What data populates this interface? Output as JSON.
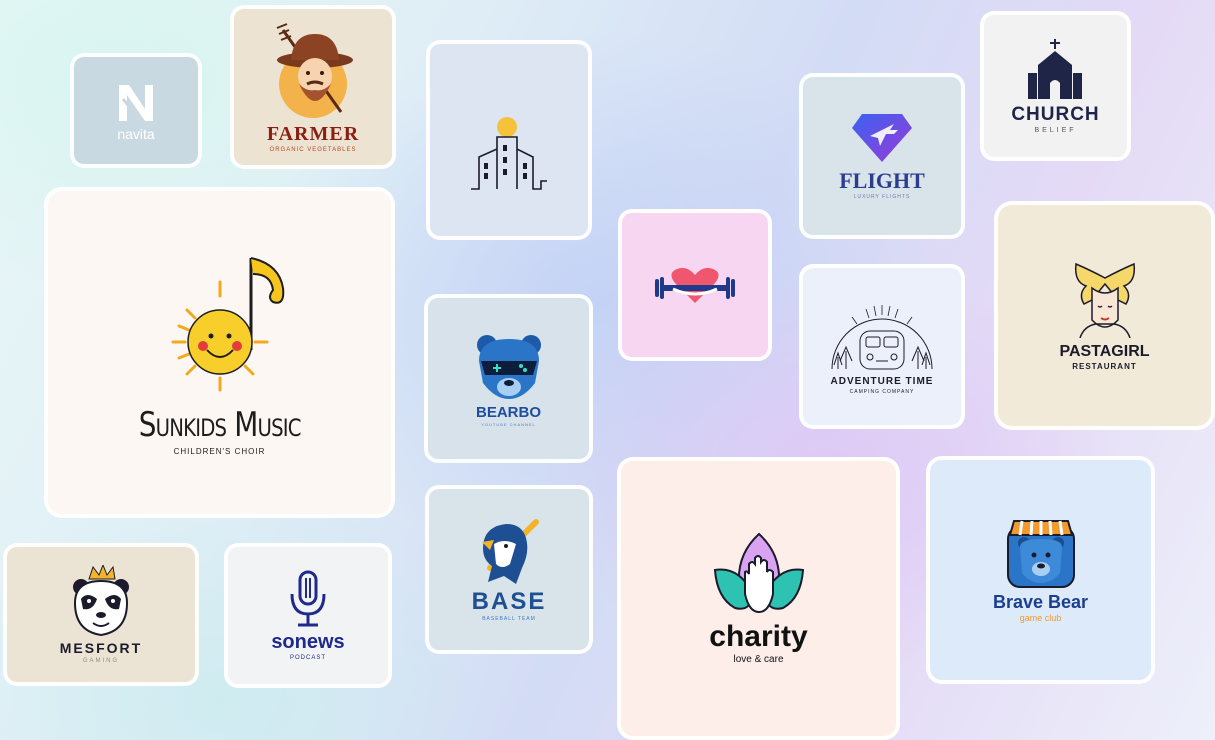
{
  "logos": {
    "navita": {
      "name": "navita",
      "letter": "N"
    },
    "farmer": {
      "name": "FARMER",
      "tagline": "ORGANIC VEGETABLES"
    },
    "sunkids": {
      "name": "Sunkids Music",
      "tagline": "CHILDREN'S CHOIR"
    },
    "flight": {
      "name": "FLIGHT",
      "tagline": "LUXURY FLIGHTS"
    },
    "church": {
      "name": "CHURCH",
      "tagline": "BELIEF"
    },
    "pastagirl": {
      "name": "PASTAGIRL",
      "tagline": "RESTAURANT"
    },
    "adventure": {
      "name": "ADVENTURE TIME",
      "tagline": "CAMPING COMPANY"
    },
    "bearbo": {
      "name": "BEARBO",
      "tagline": "YOUTUBE CHANNEL"
    },
    "base": {
      "name": "BASE",
      "tagline": "BASEBALL TEAM"
    },
    "charity": {
      "name": "charity",
      "tagline": "love & care"
    },
    "bravebear": {
      "name": "Brave Bear",
      "tagline": "game club"
    },
    "mesfort": {
      "name": "MESFORT",
      "tagline": "GAMING"
    },
    "sonews": {
      "name": "sonews",
      "tagline": "PODCAST"
    }
  },
  "colors": {
    "navy": "#16245e",
    "farmer_red": "#8a1f12",
    "pink_heart": "#f0566e",
    "charity_purple": "#d9a2f3",
    "charity_teal": "#2ec2b3",
    "bear_blue": "#2a75c7"
  }
}
